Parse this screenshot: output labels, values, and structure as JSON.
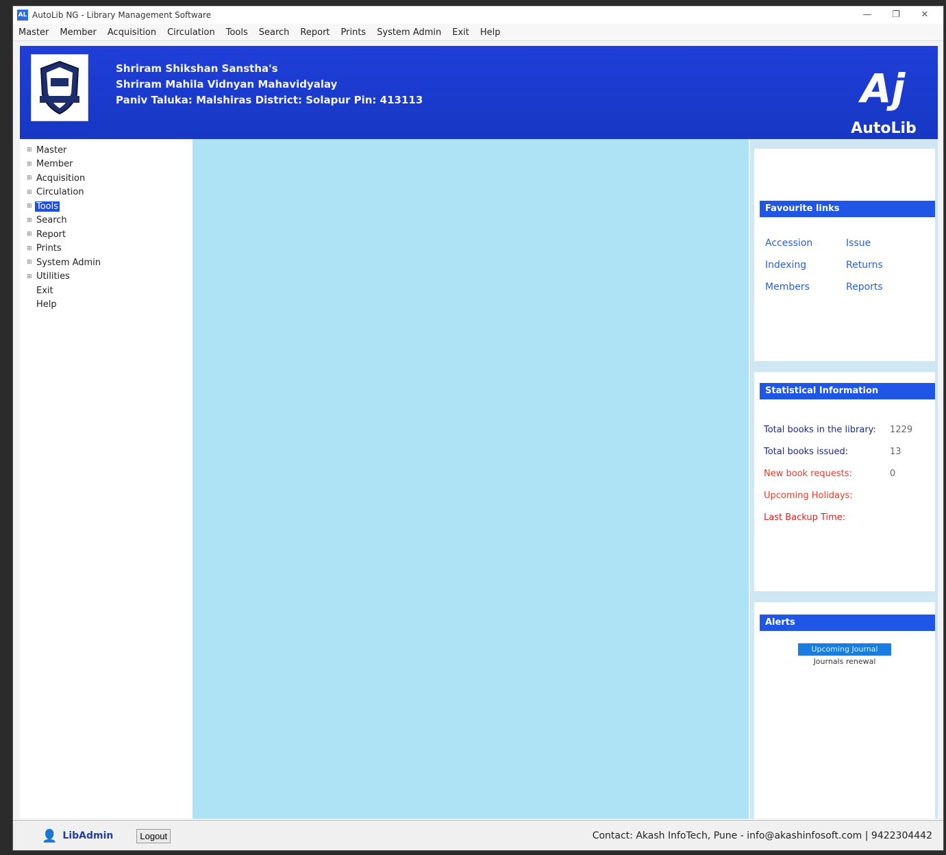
{
  "window": {
    "title": "AutoLib NG - Library Management Software",
    "app_icon": "AL"
  },
  "menubar": [
    "Master",
    "Member",
    "Acquisition",
    "Circulation",
    "Tools",
    "Search",
    "Report",
    "Prints",
    "System Admin",
    "Exit",
    "Help"
  ],
  "header": {
    "lines": [
      "Shriram Shikshan Sanstha's",
      "Shriram Mahila Vidnyan Mahavidyalay",
      "Paniv Taluka: Malshiras  District:  Solapur Pin: 413113"
    ],
    "brand_mark": "Aj",
    "brand_name": "AutoLib"
  },
  "sidebar": {
    "items": [
      {
        "label": "Master",
        "expandable": true
      },
      {
        "label": "Member",
        "expandable": true
      },
      {
        "label": "Acquisition",
        "expandable": true
      },
      {
        "label": "Circulation",
        "expandable": true
      },
      {
        "label": "Tools",
        "expandable": true,
        "selected": true
      },
      {
        "label": "Search",
        "expandable": true
      },
      {
        "label": "Report",
        "expandable": true
      },
      {
        "label": "Prints",
        "expandable": true
      },
      {
        "label": "System Admin",
        "expandable": true
      },
      {
        "label": "Utilities",
        "expandable": true
      },
      {
        "label": "Exit",
        "expandable": false
      },
      {
        "label": "Help",
        "expandable": false
      }
    ]
  },
  "favourites": {
    "title": "Favourite links",
    "links": [
      "Accession",
      "Issue",
      "Indexing",
      "Returns",
      "Members",
      "Reports"
    ]
  },
  "statistics": {
    "title": "Statistical Information",
    "rows": [
      {
        "label": "Total books in the library:",
        "value": "1229",
        "color": "#1a2a8a"
      },
      {
        "label": "Total books issued:",
        "value": "13",
        "color": "#1a2a8a"
      },
      {
        "label": "New book requests:",
        "value": "0",
        "color": "#e04030"
      },
      {
        "label": "Upcoming Holidays:",
        "value": "",
        "color": "#e04030"
      },
      {
        "label": "Last Backup Time:",
        "value": "",
        "color": "#e02020"
      }
    ]
  },
  "alerts": {
    "title": "Alerts",
    "badge": "Upcoming Journal",
    "subtext": "Journals renewal"
  },
  "status": {
    "username": "LibAdmin",
    "logout": "Logout",
    "contact": "Contact: Akash InfoTech, Pune - info@akashinfosoft.com | 9422304442"
  }
}
